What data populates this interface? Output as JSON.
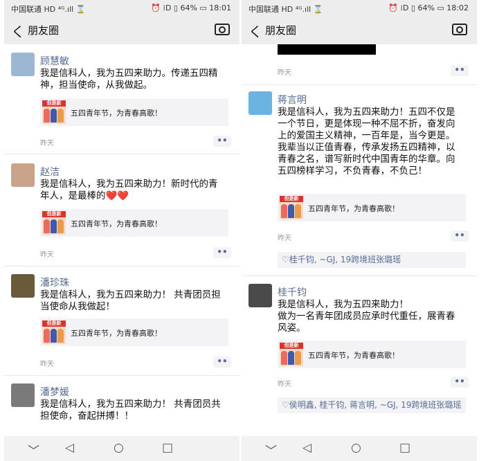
{
  "status_left": {
    "carrier": "中国联通 HD ⁴ᴳ.ıll ⌛",
    "right": "⏰ ⁞D ▯ 64% ▭ 18:01"
  },
  "status_right": {
    "carrier": "中国联通 HD ⁴ᴳ.ıll ⌛",
    "right": "⏰ ⁞D ▯ 64% ▭ 18:02"
  },
  "nav": {
    "back_glyph": "く",
    "title": "朋友圈"
  },
  "share_card_text": "五四青年节，为青春高歌！",
  "share_thumb_text": "但是新",
  "time_label": "昨天",
  "more_glyph": "••",
  "left_posts": [
    {
      "name": "顾慧敏",
      "text": "我是信科人，我为五四来助力。传递五四精神，担当使命，从我做起。",
      "avatar_color": "#9bb7d4"
    },
    {
      "name": "赵洁",
      "text": "我是信科人，我为五四来助力！新时代的青年人，是最棒的❤️❤️",
      "avatar_color": "#c9a48a"
    },
    {
      "name": "潘珍珠",
      "text": "我是信科人，我为五四来助力！ 共青团员担当使命从我做起！",
      "avatar_color": "#6b5a3a"
    },
    {
      "name": "潘梦媛",
      "text": "我是信科人，我为五四来助力！  共青团员共担使命，奋起拼搏！！",
      "avatar_color": "#7a7a7a"
    }
  ],
  "right_posts": [
    {
      "name": "蒋言明",
      "text": "我是信科人，我为五四来助力！五四不仅是一个节日，更是体现一种不屈不折，奋发向上的爱国主义精神，一百年是，当今更是。我辈当以正值青春，传承发扬五四精神，以青春之名，谱写新时代中国青年的华章。向五四榜样学习，不负青春，不负己！",
      "avatar_color": "#6bb3e0",
      "likes": "♡桂千钧, ~GJ, 19跨境班张璐瑶"
    },
    {
      "name": "桂千钧",
      "text": "我是信科人，我为五四来助力！\n做为一名青年团成员应承时代重任，展青春风姿。",
      "avatar_color": "#4a4a4a",
      "likes": "♡侯明鑫, 桂千钧, 蒋言明, ~GJ, 19跨境班张璐瑶"
    }
  ],
  "navbar": {
    "down": "﹀",
    "back": "◁",
    "home": "○",
    "recent": "□"
  },
  "colors": {
    "link_blue": "#576b95",
    "bar_gray": "#ededed",
    "card_gray": "#f3f3f5"
  }
}
